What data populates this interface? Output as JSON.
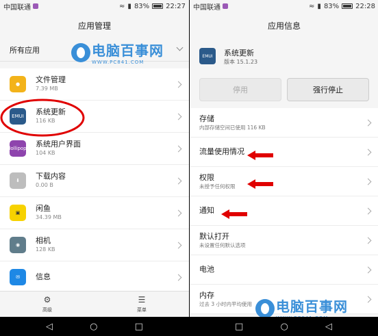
{
  "left": {
    "status": {
      "carrier": "中国联通",
      "battery": "83%",
      "time": "22:27"
    },
    "title": "应用管理",
    "filter": "所有应用",
    "apps": [
      {
        "name": "文件管理",
        "size": "7.39 MB",
        "icon": "folder-icon",
        "color": "#f3b31a"
      },
      {
        "name": "系统更新",
        "size": "116 KB",
        "icon": "emui-icon",
        "color": "#2b5a8a"
      },
      {
        "name": "系统用户界面",
        "size": "104 KB",
        "icon": "lollipop-icon",
        "color": "#8e44ad"
      },
      {
        "name": "下载内容",
        "size": "0.00 B",
        "icon": "download-icon",
        "color": "#9e9e9e"
      },
      {
        "name": "闲鱼",
        "size": "34.39 MB",
        "icon": "xianyu-icon",
        "color": "#f7d200"
      },
      {
        "name": "相机",
        "size": "128 KB",
        "icon": "camera-icon",
        "color": "#607d8b"
      },
      {
        "name": "信息",
        "size": "",
        "icon": "message-icon",
        "color": "#1e88e5"
      }
    ],
    "tools": {
      "advanced": "高级",
      "menu": "菜单"
    }
  },
  "right": {
    "status": {
      "carrier": "中国联通",
      "battery": "83%",
      "time": "22:28"
    },
    "title": "应用信息",
    "app": {
      "name": "系统更新",
      "version": "版本 15.1.23",
      "icon_text": "EMUI"
    },
    "buttons": {
      "disable": "停用",
      "force_stop": "强行停止"
    },
    "settings": [
      {
        "title": "存储",
        "sub": "内部存储空间已使用 116 KB"
      },
      {
        "title": "流量使用情况",
        "sub": ""
      },
      {
        "title": "权限",
        "sub": "未授予任何权限"
      },
      {
        "title": "通知",
        "sub": ""
      },
      {
        "title": "默认打开",
        "sub": "未设置任何默认选项"
      },
      {
        "title": "电池",
        "sub": ""
      },
      {
        "title": "内存",
        "sub": "过去 3 小时内平均使用"
      }
    ]
  },
  "watermark": {
    "brand": "电脑百事网",
    "url": "WWW.PC841.COM"
  },
  "colors": {
    "highlight_red": "#e00000",
    "watermark_blue": "#3a8fd8"
  },
  "battery_level": 0.83
}
